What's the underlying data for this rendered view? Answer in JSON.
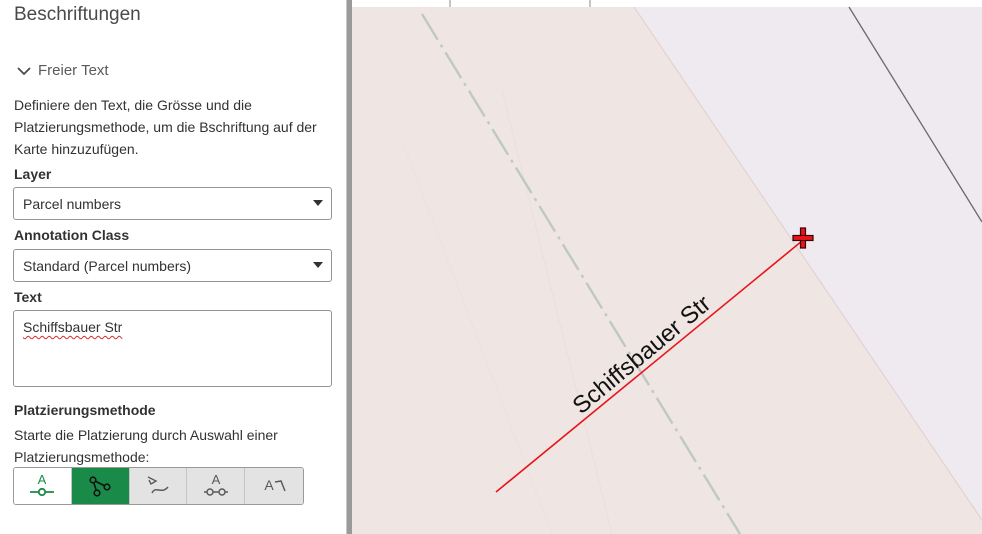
{
  "panel": {
    "title": "Beschriftungen",
    "section": {
      "label": "Freier Text",
      "expanded": true,
      "icon": "chevron-down-icon"
    },
    "description": "Definiere den Text, die Grösse und die Platzierungsmethode, um die Bschriftung auf der Karte hinzuzufügen.",
    "layer": {
      "label": "Layer",
      "value": "Parcel numbers"
    },
    "annotation_class": {
      "label": "Annotation Class",
      "value": "Standard (Parcel numbers)"
    },
    "text": {
      "label": "Text",
      "value": "Schiffsbauer Str"
    },
    "placement": {
      "label": "Platzierungsmethode",
      "hint": "Starte die Platzierung durch Auswahl einer Platzierungsmethode:",
      "methods": [
        {
          "icon": "horizontal-text-icon",
          "selected": false
        },
        {
          "icon": "straight-line-text-icon",
          "selected": true
        },
        {
          "icon": "curved-text-icon",
          "selected": false
        },
        {
          "icon": "leader-text-icon",
          "selected": false
        },
        {
          "icon": "follow-feature-text-icon",
          "selected": false
        }
      ]
    }
  },
  "map": {
    "annotation_label": "Schiffsbauer Str",
    "colors": {
      "background": "#efe9f0",
      "parcel_fill": "#efe5e2",
      "sketch_line": "#e8141c",
      "accent_green": "#1a8a49"
    }
  }
}
